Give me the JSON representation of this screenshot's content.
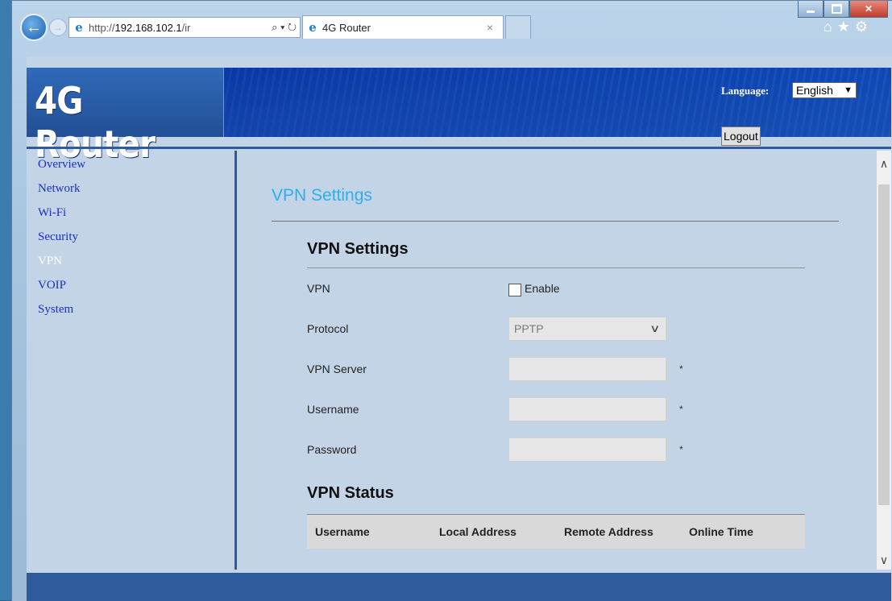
{
  "browser": {
    "url_prefix": "http://",
    "url_host": "192.168.102.1",
    "url_rest": "/ir",
    "address_tools": "⌕ ▾ ↻",
    "tab_title": "4G Router",
    "tab_close": "×",
    "right_icons": "⌂★⚙",
    "back": "←",
    "forward": "→"
  },
  "header": {
    "logo": "4G Router",
    "language_label": "Language:",
    "language_value": "English",
    "logout_label": "Logout"
  },
  "sidebar": {
    "items": [
      {
        "label": "Overview"
      },
      {
        "label": "Network"
      },
      {
        "label": "Wi-Fi"
      },
      {
        "label": "Security"
      },
      {
        "label": "VPN"
      },
      {
        "label": "VOIP"
      },
      {
        "label": "System"
      }
    ],
    "active": "VPN"
  },
  "main": {
    "page_title": "VPN Settings",
    "section_title": "VPN Settings",
    "vpn_label": "VPN",
    "enable_label": "Enable",
    "protocol_label": "Protocol",
    "protocol_value": "PPTP",
    "server_label": "VPN Server",
    "username_label": "Username",
    "password_label": "Password",
    "required_mark": "*",
    "status_title": "VPN Status",
    "status_columns": [
      "Username",
      "Local Address",
      "Remote Address",
      "Online Time"
    ]
  },
  "colors": {
    "accent_title": "#2eaef0",
    "nav_link": "#1a2fc7",
    "banner": "#2d5b9c"
  }
}
